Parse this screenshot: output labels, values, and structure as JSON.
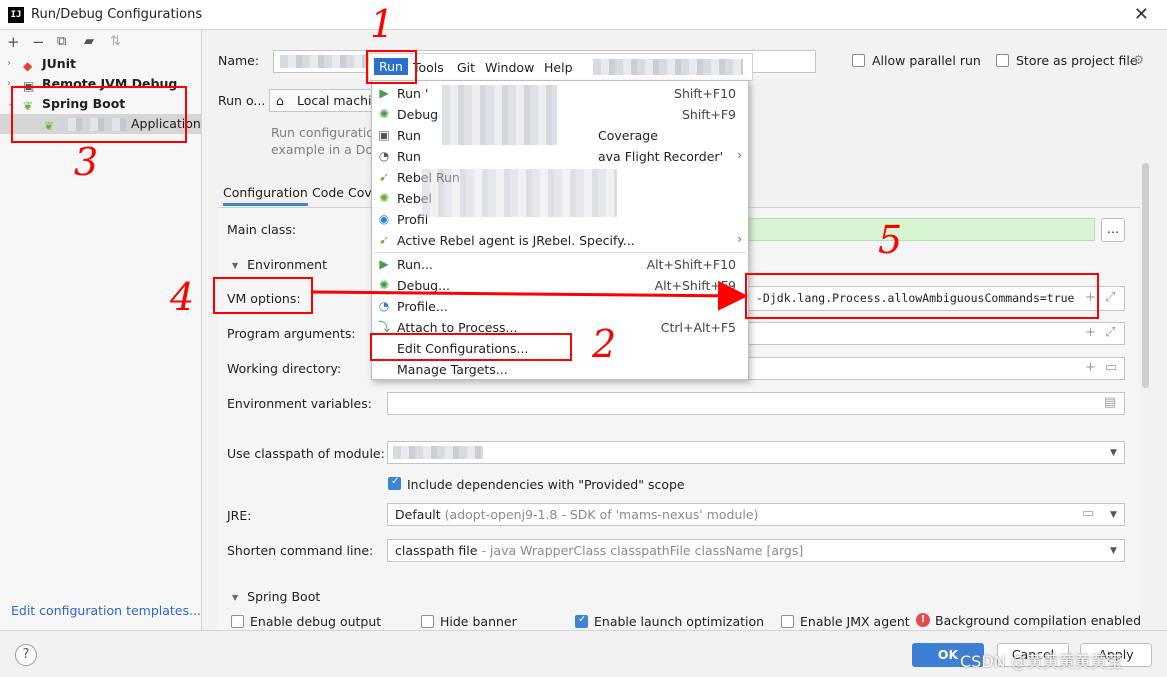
{
  "window": {
    "title": "Run/Debug Configurations",
    "app_icon": "IJ"
  },
  "left": {
    "toolbar": [
      "+",
      "−",
      "copy-icon",
      "folder-add-icon",
      "sort-icon"
    ],
    "tree": [
      {
        "label": "JUnit",
        "icon": "junit-icon"
      },
      {
        "label": "Remote JVM Debug",
        "icon": "remote-debug-icon"
      },
      {
        "label": "Spring Boot",
        "icon": "spring-boot-icon"
      },
      {
        "label": "Application",
        "icon": "spring-app-icon"
      }
    ],
    "edit_templates_link": "Edit configuration templates..."
  },
  "form": {
    "name_label": "Name:",
    "allow_parallel": "Allow parallel run",
    "store_as_project": "Store as project file",
    "run_on_label": "Run o...",
    "run_on_value": "Local machine",
    "run_config_desc_1": "Run configuration",
    "run_config_desc_2": "example in a Doc",
    "tabs": [
      "Configuration",
      "Code Cove"
    ],
    "main_class_label": "Main class:",
    "environment_head": "Environment",
    "vm_options_label": "VM options:",
    "vm_options_value": "-Djdk.lang.Process.allowAmbiguousCommands=true",
    "program_args_label": "Program arguments:",
    "working_dir_label": "Working directory:",
    "env_vars_label": "Environment variables:",
    "classpath_label": "Use classpath of module:",
    "include_deps": "Include dependencies with \"Provided\" scope",
    "jre_label": "JRE:",
    "jre_value": "Default",
    "jre_hint": "(adopt-openj9-1.8 - SDK of 'mams-nexus' module)",
    "shorten_label": "Shorten command line:",
    "shorten_value": "classpath file",
    "shorten_hint": "- java WrapperClass classpathFile className [args]",
    "spring_boot_head": "Spring Boot",
    "enable_debug_output": "Enable debug output",
    "hide_banner": "Hide banner",
    "enable_launch_opt": "Enable launch optimization",
    "enable_jmx": "Enable JMX agent",
    "bg_compilation": "Background compilation enabled"
  },
  "menubar": [
    "Run",
    "Tools",
    "Git",
    "Window",
    "Help"
  ],
  "menu": {
    "items": [
      {
        "label": "Run '",
        "shortcut": "Shift+F10",
        "icon": "run-icon"
      },
      {
        "label": "Debug",
        "shortcut": "Shift+F9",
        "icon": "debug-icon"
      },
      {
        "label": "Run",
        "suffix": "Coverage",
        "shortcut": "",
        "icon": "coverage-icon"
      },
      {
        "label": "Run",
        "suffix": "ava Flight Recorder'",
        "shortcut": "",
        "icon": "profiler-icon"
      },
      {
        "label": "Rebel Run",
        "shortcut": "",
        "icon": "jrebel-run-icon"
      },
      {
        "label": "Rebel",
        "shortcut": "",
        "icon": "jrebel-debug-icon"
      },
      {
        "label": "Profil",
        "shortcut": "",
        "icon": "profile-icon"
      },
      {
        "label": "Active Rebel agent is JRebel. Specify...",
        "shortcut": "",
        "icon": "jrebel-agent-icon"
      },
      {
        "label": "Run...",
        "shortcut": "Alt+Shift+F10",
        "icon": "run-icon"
      },
      {
        "label": "Debug...",
        "shortcut": "Alt+Shift+F9",
        "icon": "debug-icon"
      },
      {
        "label": "Profile...",
        "shortcut": "",
        "icon": "profile-icon"
      },
      {
        "label": "Attach to Process...",
        "shortcut": "Ctrl+Alt+F5",
        "icon": "attach-icon"
      },
      {
        "label": "Edit Configurations...",
        "shortcut": "",
        "icon": ""
      },
      {
        "label": "Manage Targets...",
        "shortcut": "",
        "icon": ""
      }
    ]
  },
  "buttons": {
    "ok": "OK",
    "cancel": "Cancel",
    "apply": "Apply",
    "help": "?"
  },
  "watermark": "CSDN @黄黄黄黄黄莹",
  "annotations": [
    "1",
    "2",
    "3",
    "4",
    "5"
  ],
  "colors": {
    "accent": "#3d7fd4",
    "annotation": "#ff0000",
    "main_class_bg": "#d6f5d0"
  }
}
